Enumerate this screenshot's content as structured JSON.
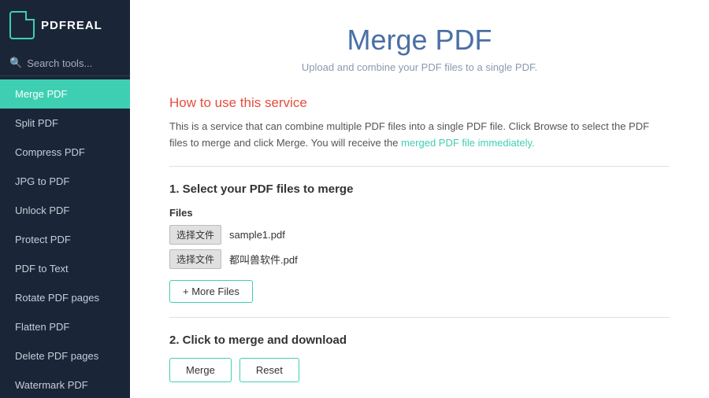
{
  "app": {
    "logo_text": "PDFREAL"
  },
  "sidebar": {
    "search_placeholder": "Search tools...",
    "items": [
      {
        "id": "merge-pdf",
        "label": "Merge PDF",
        "active": true
      },
      {
        "id": "split-pdf",
        "label": "Split PDF",
        "active": false
      },
      {
        "id": "compress-pdf",
        "label": "Compress PDF",
        "active": false
      },
      {
        "id": "jpg-to-pdf",
        "label": "JPG to PDF",
        "active": false
      },
      {
        "id": "unlock-pdf",
        "label": "Unlock PDF",
        "active": false
      },
      {
        "id": "protect-pdf",
        "label": "Protect PDF",
        "active": false
      },
      {
        "id": "pdf-to-text",
        "label": "PDF to Text",
        "active": false
      },
      {
        "id": "rotate-pdf",
        "label": "Rotate PDF pages",
        "active": false
      },
      {
        "id": "flatten-pdf",
        "label": "Flatten PDF",
        "active": false
      },
      {
        "id": "delete-pdf-pages",
        "label": "Delete PDF pages",
        "active": false
      },
      {
        "id": "watermark-pdf",
        "label": "Watermark PDF",
        "active": false
      }
    ]
  },
  "main": {
    "page_title": "Merge PDF",
    "page_subtitle": "Upload and combine your PDF files to a single PDF.",
    "how_to_heading": "How to use this service",
    "description_part1": "This is a service that can combine multiple PDF files into a single PDF file. Click Browse to select the PDF files to merge and click Merge. You will receive the merged PDF file immediately.",
    "step1_heading": "1. Select your PDF files to merge",
    "files_label": "Files",
    "file1_btn": "选择文件",
    "file1_name": "sample1.pdf",
    "file2_btn": "选择文件",
    "file2_name": "都叫兽软件.pdf",
    "more_files_btn": "+ More Files",
    "step2_heading": "2. Click to merge and download",
    "merge_btn": "Merge",
    "reset_btn": "Reset"
  },
  "colors": {
    "accent": "#3ecfb2",
    "active_bg": "#3ecfb2",
    "sidebar_bg": "#1a2638",
    "red_heading": "#e74c3c",
    "blue_title": "#4a6fa5"
  }
}
